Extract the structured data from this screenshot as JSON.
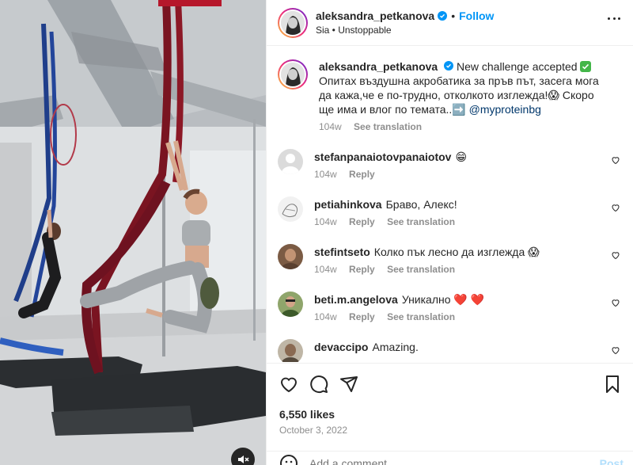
{
  "post": {
    "author": "aleksandra_petkanova",
    "verified": true,
    "follow_label": "Follow",
    "audio": "Sia",
    "song": "Unstoppable",
    "caption_prefix": "New challenge accepted",
    "caption_body": "Опитах въздушна акробатика за пръв път, засега мога да кажа,че е по-трудно, отколкото изглежда!😱 Скоро ще има и влог по темата..➡️",
    "mention": "@myproteinbg",
    "caption_age": "104w",
    "see_translation": "See translation"
  },
  "comments": [
    {
      "user": "stefanpanaiotovpanaiotov",
      "text": "😁",
      "age": "104w",
      "reply": "Reply",
      "translate": ""
    },
    {
      "user": "petiahinkova",
      "text": "Браво, Алекс!",
      "age": "104w",
      "reply": "Reply",
      "translate": "See translation"
    },
    {
      "user": "stefintseto",
      "text": "Колко пък лесно да изглежда 😱",
      "age": "104w",
      "reply": "Reply",
      "translate": "See translation"
    },
    {
      "user": "beti.m.angelova",
      "text": "Уникално ❤️ ❤️",
      "age": "104w",
      "reply": "Reply",
      "translate": "See translation"
    },
    {
      "user": "devaccipo",
      "text": "Amazing.",
      "age": "",
      "reply": "",
      "translate": ""
    }
  ],
  "footer": {
    "likes": "6,550 likes",
    "date": "October 3, 2022",
    "add_placeholder": "Add a comment...",
    "post_label": "Post"
  },
  "icons": [
    "heart-icon",
    "comment-icon",
    "share-icon",
    "bookmark-icon",
    "emoji-icon",
    "mute-icon",
    "more-icon",
    "verified-icon"
  ],
  "colors": {
    "accent": "#0095f6",
    "verified": "#0095f6",
    "muted": "#8e8e8e",
    "text": "#262626"
  }
}
